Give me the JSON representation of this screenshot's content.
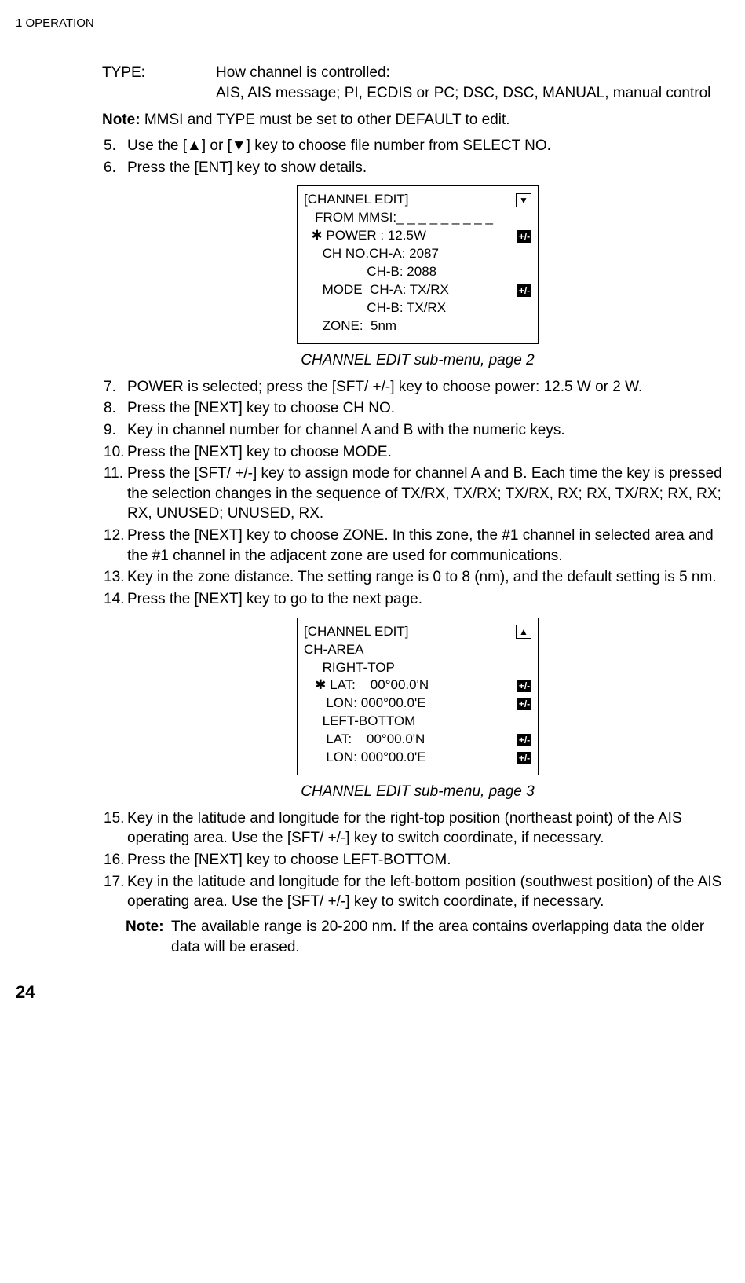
{
  "header": {
    "section": "1  OPERATION"
  },
  "typeDef": {
    "label": "TYPE:",
    "line1": "How channel is controlled:",
    "line2": "AIS, AIS message; PI, ECDIS or PC; DSC, DSC, MANUAL, manual control"
  },
  "note1": {
    "label": "Note:",
    "text": " MMSI and TYPE must be set to other DEFAULT to edit."
  },
  "steps": {
    "s5": {
      "num": "5.",
      "text": "Use the [▲] or [▼] key to choose file number from SELECT NO."
    },
    "s6": {
      "num": "6.",
      "text": "Press the [ENT] key to show details."
    },
    "s7": {
      "num": "7.",
      "text": "POWER is selected; press the [SFT/ +/-] key to choose power: 12.5 W or 2 W."
    },
    "s8": {
      "num": "8.",
      "text": "Press the [NEXT] key to choose CH NO."
    },
    "s9": {
      "num": "9.",
      "text": "Key in channel number for channel A and B with the numeric keys."
    },
    "s10": {
      "num": "10.",
      "text": "Press the [NEXT] key to choose MODE."
    },
    "s11": {
      "num": "11.",
      "text": "Press the [SFT/ +/-] key to assign mode for channel A and B. Each time the key is pressed the selection changes in the sequence of TX/RX, TX/RX; TX/RX, RX; RX, TX/RX; RX, RX; RX, UNUSED; UNUSED, RX."
    },
    "s12": {
      "num": "12.",
      "text": "Press the [NEXT] key to choose ZONE. In this zone, the #1 channel in selected area and the #1 channel in the adjacent zone are used for communications."
    },
    "s13": {
      "num": "13.",
      "text": "Key in the zone distance. The setting range is 0 to 8 (nm), and the default setting is 5 nm."
    },
    "s14": {
      "num": "14.",
      "text": "Press the [NEXT] key to go to the next page."
    },
    "s15": {
      "num": "15.",
      "text": "Key in the latitude and longitude for the right-top position (northeast point) of the AIS operating area. Use the [SFT/ +/-] key to switch coordinate, if necessary."
    },
    "s16": {
      "num": "16.",
      "text": "Press the [NEXT] key to choose LEFT-BOTTOM."
    },
    "s17": {
      "num": "17.",
      "text": "Key in the latitude and longitude for the left-bottom position (southwest position) of the AIS operating area. Use the [SFT/ +/-] key to switch coordinate, if necessary."
    }
  },
  "screen1": {
    "title": "[CHANNEL EDIT]",
    "l2": "   FROM MMSI:_ _ _ _ _ _ _ _ _",
    "l3a": "  ✱ POWER : 12.5W",
    "l4": "     CH NO.CH-A: 2087",
    "l5": "                 CH-B: 2088",
    "l6a": "     MODE  CH-A: TX/RX",
    "l7": "                 CH-B: TX/RX",
    "l8": "     ZONE:  5nm",
    "downArrow": "▼",
    "pm": "+/-"
  },
  "caption1": "CHANNEL EDIT sub-menu, page 2",
  "screen2": {
    "title": "[CHANNEL EDIT]",
    "l2": "CH-AREA",
    "l3": "     RIGHT-TOP",
    "l4a": "   ✱ LAT:    00°00.0'N",
    "l5a": "      LON: 000°00.0'E",
    "l6": "     LEFT-BOTTOM",
    "l7a": "      LAT:    00°00.0'N",
    "l8a": "      LON: 000°00.0'E",
    "upArrow": "▲",
    "pm": "+/-"
  },
  "caption2": "CHANNEL EDIT sub-menu, page 3",
  "note2": {
    "label": "Note:",
    "text": "The available range is 20-200 nm. If the area contains overlapping data the older data will be erased."
  },
  "pageNum": "24"
}
